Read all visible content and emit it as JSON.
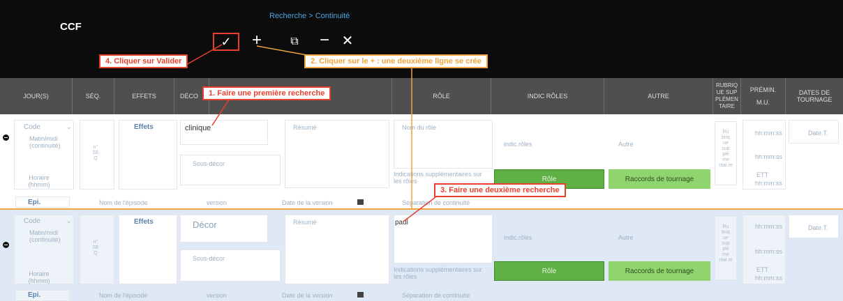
{
  "app": {
    "title": "CCF",
    "breadcrumb": "Recherche > Continuité"
  },
  "toolbar": {
    "validate": "✓",
    "add": "+",
    "copy": "⧉",
    "remove": "−",
    "close": "✕"
  },
  "callouts": {
    "c1": "1. Faire une première recherche",
    "c2": "2. Cliquer sur le + : une deuxième ligne se crée",
    "c3": "3. Faire une deuxième recherche",
    "c4": "4. Cliquer sur Valider"
  },
  "columns": {
    "jours": "JOUR(S)",
    "seq": "SÉQ.",
    "effets": "EFFETS",
    "decor": "DÉCO",
    "role": "RÔLE",
    "indic_roles": "INDIC RÔLES",
    "autre": "AUTRE",
    "rubrique": "RUBRIQUE SUPPLÉMENTAIRE",
    "premin": "PRÉMIN.",
    "mu": "M.U.",
    "dates": "DATES DE TOURNAGE"
  },
  "rows": [
    {
      "code": "Code",
      "matin_midi": "Matin/midi (continuité)",
      "horaire": "Horaire (hhmm)",
      "seq": "n° SE Q",
      "effets": "Effets",
      "decor_value": "clinique",
      "decor_placeholder": "",
      "sous_decor": "Sous-décor",
      "resume": "Résumé",
      "role_value": "",
      "role_placeholder": "Nom du rôle",
      "indications": "Indications supplémentaires sur les rôles",
      "indic_roles": "indic.rôles",
      "role_button": "Rôle",
      "autre": "Autre",
      "raccords_button": "Raccords de tournage",
      "rubrique": "Ru briq ue sup plé me ntai re",
      "hhmmss": "hh:mm:ss",
      "hhmmss2": "hh:mm:ss",
      "ett": "ETT",
      "ett_sub": "hh:mm:ss",
      "date_t": "Date.T.",
      "epi": "Epi.",
      "nom_episode": "Nom de l'épisode",
      "version": "version",
      "date_version": "Date de la version",
      "separation": "Séparation de continuité"
    },
    {
      "code": "Code",
      "matin_midi": "Matin/midi (continuité)",
      "horaire": "Horaire (hhmm)",
      "seq": "n° SE Q",
      "effets": "Effets",
      "decor_value": "",
      "decor_placeholder": "Décor",
      "sous_decor": "Sous-décor",
      "resume": "Résumé",
      "role_value": "paul",
      "role_placeholder": "",
      "indications": "Indications supplémentaires sur les rôles",
      "indic_roles": "indic.rôles",
      "role_button": "Rôle",
      "autre": "Autre",
      "raccords_button": "Raccords de tournage",
      "rubrique": "Ru briq ue sup plé me ntai re",
      "hhmmss": "hh:mm:ss",
      "hhmmss2": "hh:mm:ss",
      "ett": "ETT",
      "ett_sub": "hh:mm:ss",
      "date_t": "Date.T.",
      "epi": "Epi.",
      "nom_episode": "Nom de l'épisode",
      "version": "version",
      "date_version": "Date de la version",
      "separation": "Séparation de continuité"
    }
  ],
  "colors": {
    "accent_red": "#e8402f",
    "accent_orange": "#f0a43c",
    "green_button": "#5fb145",
    "light_green_button": "#8fd46e"
  }
}
